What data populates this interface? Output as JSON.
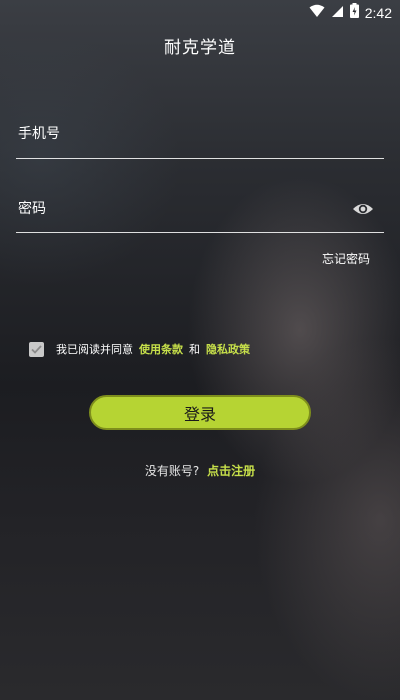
{
  "status_bar": {
    "time": "2:42",
    "icons": [
      "wifi-icon",
      "cell-signal-icon",
      "battery-icon"
    ]
  },
  "app": {
    "title": "耐克学道"
  },
  "form": {
    "phone_placeholder": "手机号",
    "password_placeholder": "密码",
    "forgot_password": "忘记密码",
    "show_password_icon": "eye-icon"
  },
  "agreement": {
    "checked": true,
    "prefix": "我已阅读并同意",
    "terms": "使用条款",
    "and": "和",
    "privacy": "隐私政策"
  },
  "login_button": "登录",
  "register": {
    "prompt": "没有账号?",
    "link": "点击注册"
  },
  "colors": {
    "accent": "#b6d433",
    "link": "#c7e04a",
    "background": "#1f2024"
  }
}
